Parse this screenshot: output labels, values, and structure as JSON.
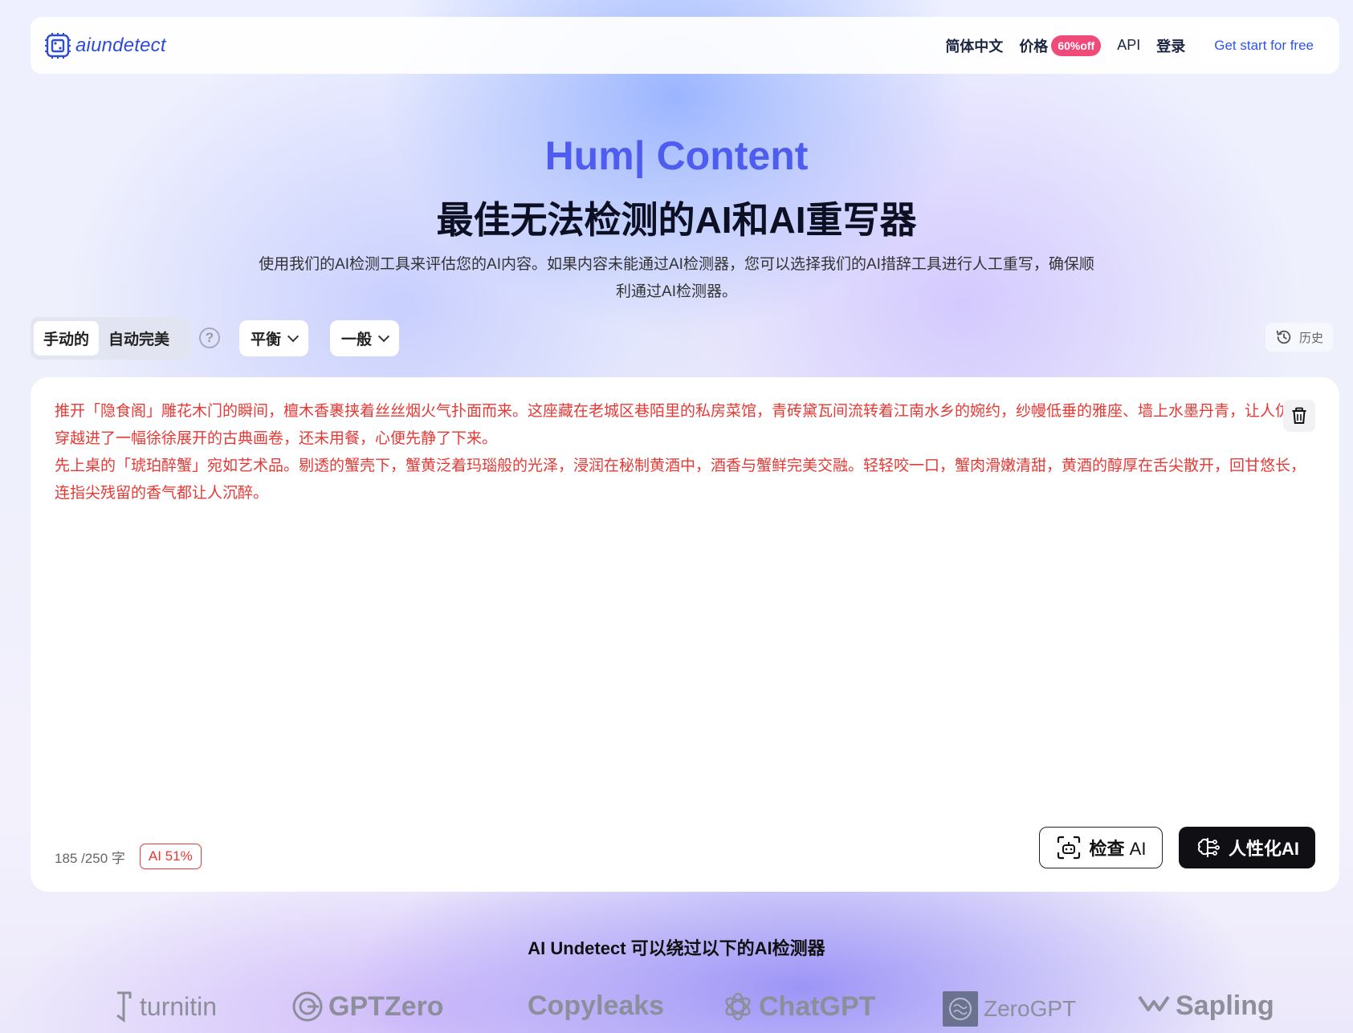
{
  "header": {
    "logo_text": "aiundetect",
    "nav": [
      {
        "label": "简体中文"
      },
      {
        "label": "价格",
        "badge": "60%off"
      },
      {
        "label": "API"
      },
      {
        "label": "登录"
      }
    ],
    "cta_label": "Get start for free"
  },
  "hero": {
    "title1": "Hum| Content",
    "title2": "最佳无法检测的AI和AI重写器",
    "desc": "使用我们的AI检测工具来评估您的AI内容。如果内容未能通过AI检测器，您可以选择我们的AI措辞工具进行人工重写，确保顺利通过AI检测器。"
  },
  "controls": {
    "modes": [
      "手动的",
      "自动完美"
    ],
    "active_mode": "手动的",
    "help_symbol": "?",
    "dropdown_strength": "平衡",
    "dropdown_purpose": "一般",
    "history_label": "历史"
  },
  "editor": {
    "paragraph1": "推开「隐食阁」雕花木门的瞬间，檀木香裹挟着丝丝烟火气扑面而来。这座藏在老城区巷陌里的私房菜馆，青砖黛瓦间流转着江南水乡的婉约，纱幔低垂的雅座、墙上水墨丹青，让人仿佛穿越进了一幅徐徐展开的古典画卷，还未用餐，心便先静了下来。",
    "paragraph2": "先上桌的「琥珀醉蟹」宛如艺术品。剔透的蟹壳下，蟹黄泛着玛瑙般的光泽，浸润在秘制黄酒中，酒香与蟹鲜完美交融。轻轻咬一口，蟹肉滑嫩清甜，黄酒的醇厚在舌尖散开，回甘悠长，连指尖残留的香气都让人沉醉。",
    "word_count": "185 /250 字",
    "ai_score": "AI 51%",
    "check_label_bold": "检查",
    "check_label_rest": "AI",
    "humanize_label": "人性化AI"
  },
  "bypass": {
    "title_part1": "AI Undetect",
    "title_part2": "可以绕过以下的AI检测器",
    "brands": [
      "turnitin",
      "GPTZero",
      "Copyleaks",
      "ChatGPT",
      "ZeroGPT",
      "Sapling"
    ]
  },
  "colors": {
    "accent": "#4f5cf0",
    "link": "#2d55e8",
    "badge": "#f04a7b",
    "error_text": "#e53935"
  }
}
